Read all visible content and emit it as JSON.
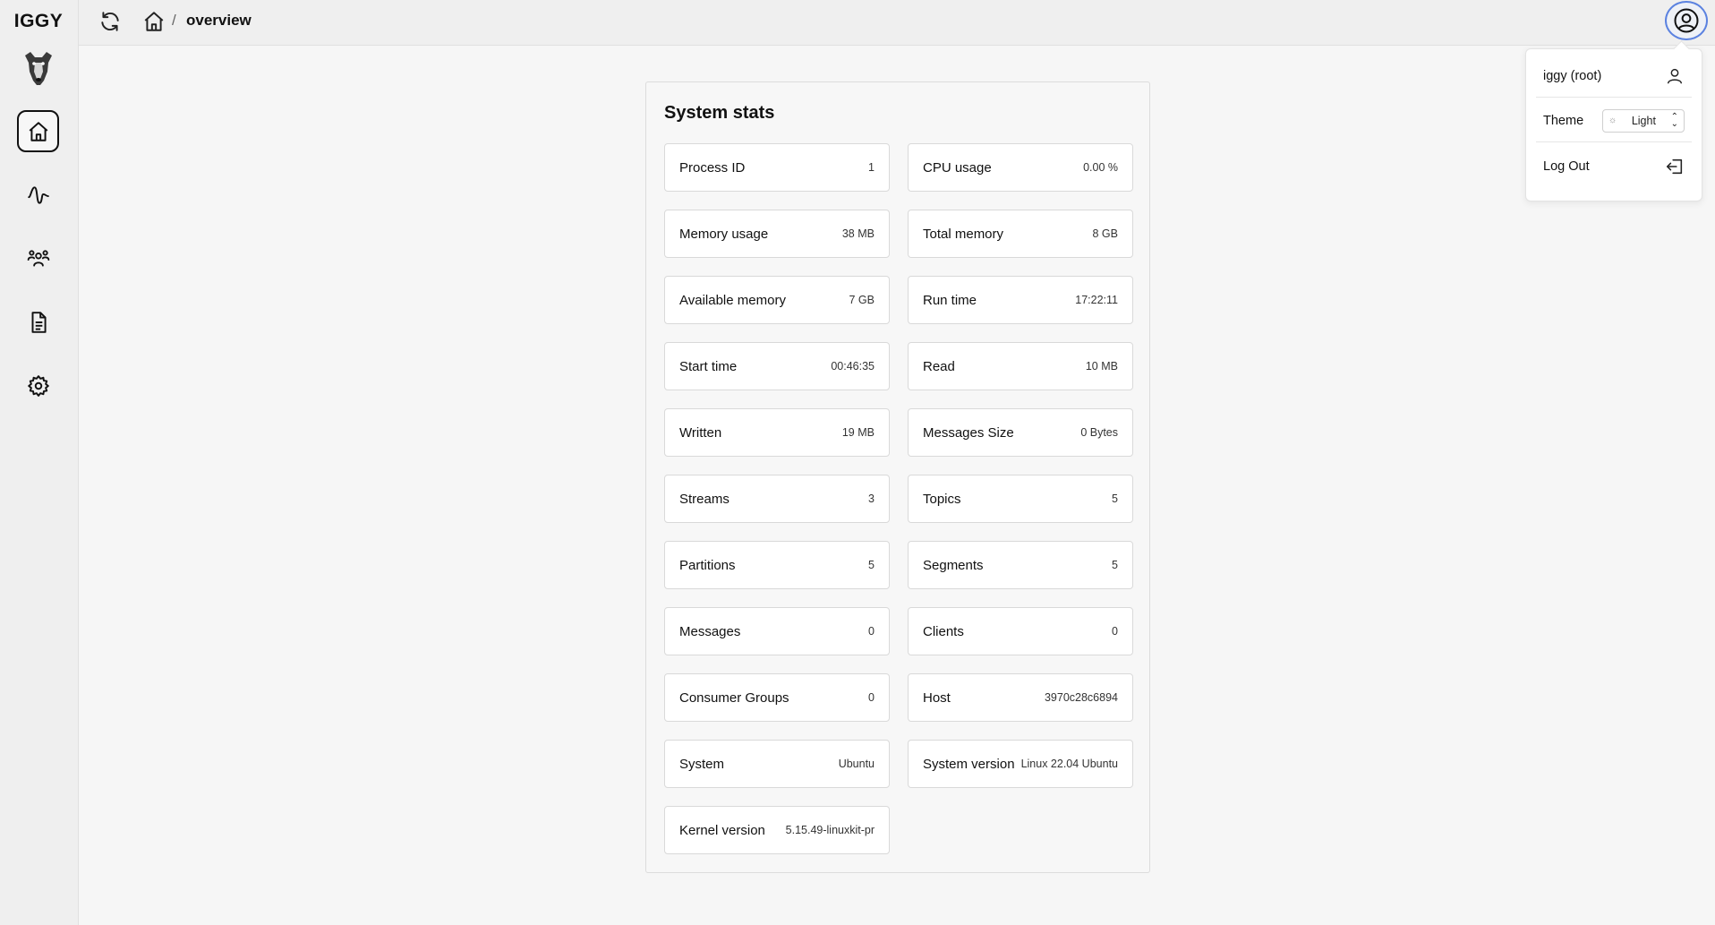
{
  "brand": "IGGY",
  "nav": [
    {
      "name": "home",
      "icon": "home-icon",
      "active": true
    },
    {
      "name": "stats",
      "icon": "waveform-icon"
    },
    {
      "name": "clients",
      "icon": "users-icon"
    },
    {
      "name": "logs",
      "icon": "document-icon"
    },
    {
      "name": "settings",
      "icon": "gear-icon"
    }
  ],
  "breadcrumb": {
    "separator": "/",
    "current": "overview"
  },
  "panel": {
    "title": "System stats"
  },
  "stats": [
    {
      "label": "Process ID",
      "value": "1"
    },
    {
      "label": "CPU usage",
      "value": "0.00 %"
    },
    {
      "label": "Memory usage",
      "value": "38 MB"
    },
    {
      "label": "Total memory",
      "value": "8 GB"
    },
    {
      "label": "Available memory",
      "value": "7 GB"
    },
    {
      "label": "Run time",
      "value": "17:22:11"
    },
    {
      "label": "Start time",
      "value": "00:46:35"
    },
    {
      "label": "Read",
      "value": "10 MB"
    },
    {
      "label": "Written",
      "value": "19 MB"
    },
    {
      "label": "Messages Size",
      "value": "0 Bytes"
    },
    {
      "label": "Streams",
      "value": "3"
    },
    {
      "label": "Topics",
      "value": "5"
    },
    {
      "label": "Partitions",
      "value": "5"
    },
    {
      "label": "Segments",
      "value": "5"
    },
    {
      "label": "Messages",
      "value": "0"
    },
    {
      "label": "Clients",
      "value": "0"
    },
    {
      "label": "Consumer Groups",
      "value": "0"
    },
    {
      "label": "Host",
      "value": "3970c28c6894"
    },
    {
      "label": "System",
      "value": "Ubuntu"
    },
    {
      "label": "System version",
      "value": "Linux 22.04 Ubuntu"
    },
    {
      "label": "Kernel version",
      "value": "5.15.49-linuxkit-pr"
    }
  ],
  "user_menu": {
    "user": "iggy (root)",
    "theme_label": "Theme",
    "theme_value": "Light",
    "logout": "Log Out"
  },
  "colors": {
    "accent_ring": "#5b82e0",
    "sidebar_bg": "#efefef",
    "page_bg": "#f6f6f6"
  }
}
